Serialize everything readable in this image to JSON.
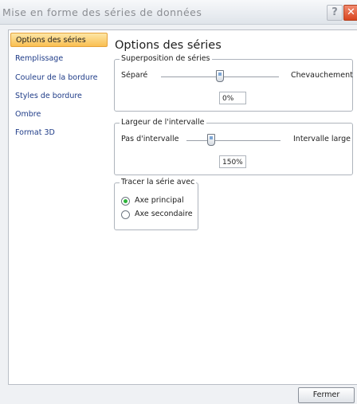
{
  "window": {
    "title": "Mise en forme des séries de données",
    "help_glyph": "?",
    "close_glyph": "✕"
  },
  "nav": {
    "items": [
      {
        "label": "Options des séries",
        "active": true
      },
      {
        "label": "Remplissage"
      },
      {
        "label": "Couleur de la bordure"
      },
      {
        "label": "Styles de bordure"
      },
      {
        "label": "Ombre"
      },
      {
        "label": "Format 3D"
      }
    ]
  },
  "panel": {
    "title": "Options des séries",
    "overlap": {
      "label": "Superposition de séries",
      "left": "Séparé",
      "right": "Chevauchement",
      "value": "0%",
      "position_fraction": 0.5
    },
    "gap": {
      "label": "Largeur de l'intervalle",
      "left": "Pas d'intervalle",
      "right": "Intervalle large",
      "value": "150%",
      "position_fraction": 0.3
    },
    "plot_on": {
      "label": "Tracer la série avec",
      "options": [
        {
          "label": "Axe principal",
          "checked": true
        },
        {
          "label": "Axe secondaire",
          "checked": false
        }
      ]
    }
  },
  "footer": {
    "close_label": "Fermer"
  },
  "colors": {
    "accent_active": "#f9bf52",
    "radio_selected": "#2db33a",
    "close_button": "#d8451f"
  }
}
